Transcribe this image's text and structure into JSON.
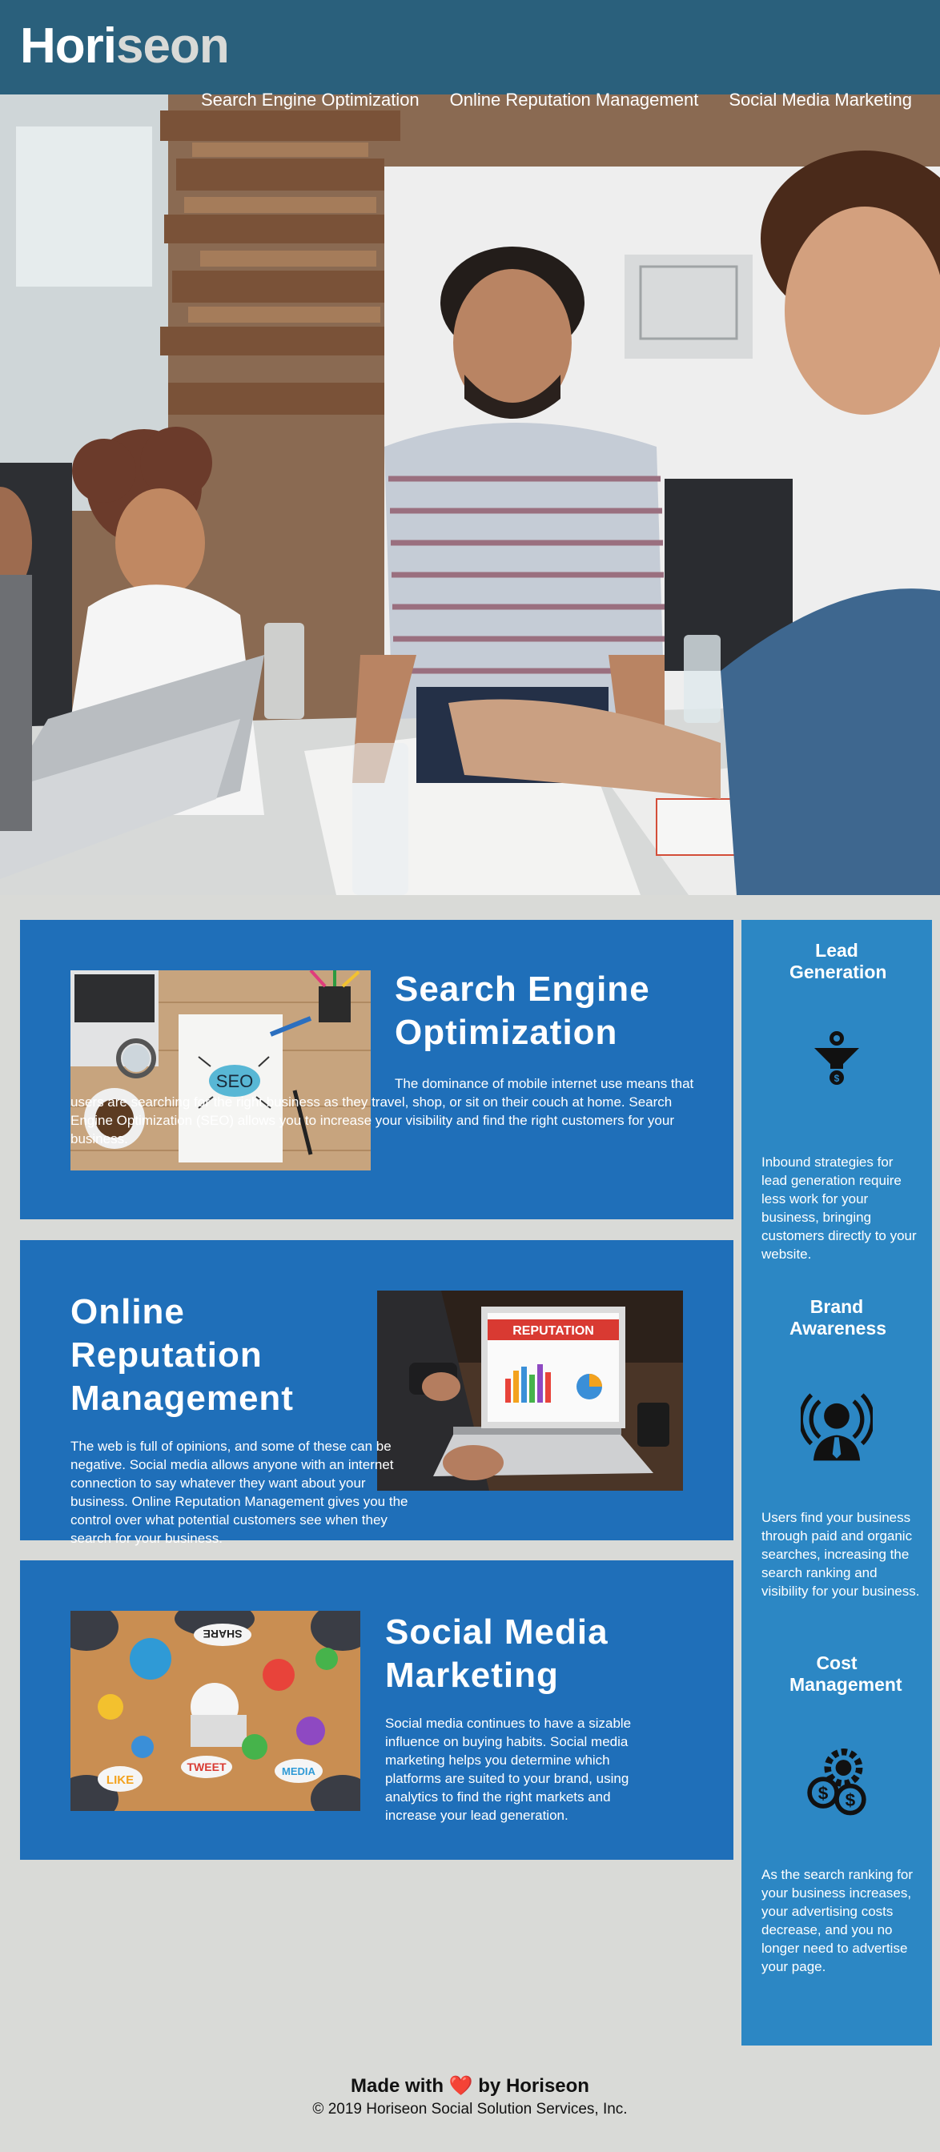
{
  "header": {
    "logo_prefix": "Hori",
    "logo_suffix": "seon",
    "nav": [
      {
        "label": "Search Engine Optimization"
      },
      {
        "label": "Online Reputation Management"
      },
      {
        "label": "Social Media Marketing"
      }
    ]
  },
  "sections": [
    {
      "title": "Search Engine Optimization",
      "body": "The dominance of mobile internet use means that users are searching for the right business as they travel, shop, or sit on their couch at home. Search Engine Optimization (SEO) allows you to increase your visibility and find the right customers for your business.",
      "image_text": "SEO"
    },
    {
      "title": "Online Reputation Management",
      "body": "The web is full of opinions, and some of these can be negative. Social media allows anyone with an internet connection to say whatever they want about your business. Online Reputation Management gives you the control over what potential customers see when they search for your business.",
      "image_text": "REPUTATION"
    },
    {
      "title": "Social Media Marketing",
      "body": "Social media continues to have a sizable influence on buying habits. Social media marketing helps you determine which platforms are suited to your brand, using analytics to find the right markets and increase your lead generation.",
      "image_words": [
        "SHARE",
        "TWEET",
        "LIKE",
        "MEDIA"
      ]
    }
  ],
  "benefits": [
    {
      "title": "Lead Generation",
      "icon": "lead-generation-icon",
      "body": "Inbound strategies for lead generation require less work for your business, bringing customers directly to your website."
    },
    {
      "title": "Brand Awareness",
      "icon": "brand-awareness-icon",
      "body": "Users find your business through paid and organic searches, increasing the search ranking and visibility for your business."
    },
    {
      "title": "Cost Management",
      "icon": "cost-management-icon",
      "body": "As the search ranking for your business increases, your advertising costs decrease, and you no longer need to advertise your page."
    }
  ],
  "footer": {
    "made_prefix": "Made with",
    "heart": "❤️",
    "made_suffix": "by Horiseon",
    "copyright": "© 2019 Horiseon Social Solution Services, Inc."
  },
  "colors": {
    "header_bg": "#2a607c",
    "page_bg": "#d9dad7",
    "card_bg": "#1f6fb9",
    "aside_bg": "#2c87c4"
  }
}
